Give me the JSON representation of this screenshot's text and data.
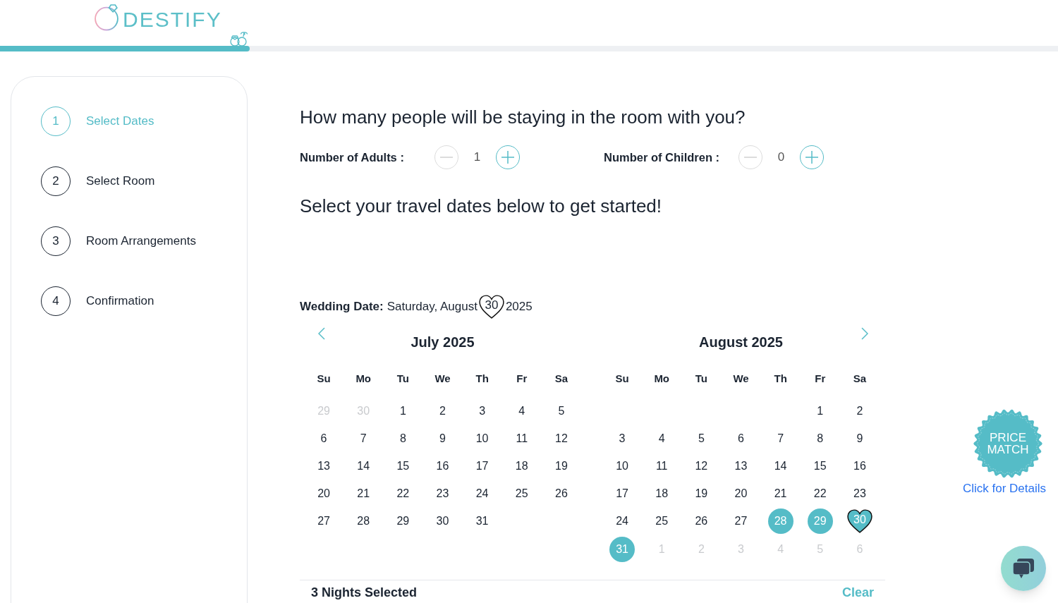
{
  "logo": {
    "text": "DESTIFY"
  },
  "progress": {
    "level": 0.236
  },
  "steps": [
    {
      "number": "1",
      "label": "Select Dates",
      "selected": true
    },
    {
      "number": "2",
      "label": "Select Room",
      "selected": false
    },
    {
      "number": "3",
      "label": "Room Arrangements",
      "selected": false
    },
    {
      "number": "4",
      "label": "Confirmation",
      "selected": false
    }
  ],
  "guests": {
    "title": "How many people will be staying in the room with you?",
    "counters": [
      {
        "label": "Number of Adults :",
        "value": "1",
        "minus_disabled": true
      },
      {
        "label": "Number of Children :",
        "value": "0",
        "minus_disabled": true
      }
    ]
  },
  "dates_prompt": "Select your travel dates below to get started!",
  "wedding_date": {
    "label": "Wedding Date:",
    "weekday_month": "Saturday, August",
    "day": "30",
    "year": "2025"
  },
  "calendar": {
    "prev_button": true,
    "next_button": true,
    "months": [
      {
        "title": "July 2025",
        "weekdays": [
          "Su",
          "Mo",
          "Tu",
          "We",
          "Th",
          "Fr",
          "Sa"
        ],
        "weeks": [
          {
            "kind": "standard",
            "days": [
              {
                "label": "29",
                "kind": "outside"
              },
              {
                "label": "30",
                "kind": "outside"
              },
              {
                "label": "1",
                "kind": "day",
                "selected": false
              },
              {
                "label": "2",
                "kind": "day",
                "selected": false
              },
              {
                "label": "3",
                "kind": "day",
                "selected": false
              },
              {
                "label": "4",
                "kind": "day",
                "selected": false
              },
              {
                "label": "5",
                "kind": "day",
                "selected": false
              }
            ]
          },
          {
            "kind": "standard",
            "days": [
              {
                "label": "6",
                "kind": "day",
                "selected": false
              },
              {
                "label": "7",
                "kind": "day",
                "selected": false
              },
              {
                "label": "8",
                "kind": "day",
                "selected": false
              },
              {
                "label": "9",
                "kind": "day",
                "selected": false
              },
              {
                "label": "10",
                "kind": "day",
                "selected": false
              },
              {
                "label": "11",
                "kind": "day",
                "selected": false
              },
              {
                "label": "12",
                "kind": "day",
                "selected": false
              }
            ]
          },
          {
            "kind": "standard",
            "days": [
              {
                "label": "13",
                "kind": "day",
                "selected": false
              },
              {
                "label": "14",
                "kind": "day",
                "selected": false
              },
              {
                "label": "15",
                "kind": "day",
                "selected": false
              },
              {
                "label": "16",
                "kind": "day",
                "selected": false
              },
              {
                "label": "17",
                "kind": "day",
                "selected": false
              },
              {
                "label": "18",
                "kind": "day",
                "selected": false
              },
              {
                "label": "19",
                "kind": "day",
                "selected": false
              }
            ]
          },
          {
            "kind": "standard",
            "days": [
              {
                "label": "20",
                "kind": "day",
                "selected": false
              },
              {
                "label": "21",
                "kind": "day",
                "selected": false
              },
              {
                "label": "22",
                "kind": "day",
                "selected": false
              },
              {
                "label": "23",
                "kind": "day",
                "selected": false
              },
              {
                "label": "24",
                "kind": "day",
                "selected": false
              },
              {
                "label": "25",
                "kind": "day",
                "selected": false
              },
              {
                "label": "26",
                "kind": "day",
                "selected": false
              }
            ]
          },
          {
            "kind": "standard",
            "days": [
              {
                "label": "27",
                "kind": "day",
                "selected": false
              },
              {
                "label": "28",
                "kind": "day",
                "selected": false
              },
              {
                "label": "29",
                "kind": "day",
                "selected": false
              },
              {
                "label": "30",
                "kind": "day",
                "selected": false
              },
              {
                "label": "31",
                "kind": "day",
                "selected": false
              }
            ]
          }
        ]
      },
      {
        "title": "August 2025",
        "weekdays": [
          "Su",
          "Mo",
          "Tu",
          "We",
          "Th",
          "Fr",
          "Sa"
        ],
        "weeks": [
          {
            "kind": "leading",
            "days": [
              {
                "label": "1",
                "kind": "day",
                "selected": false
              },
              {
                "label": "2",
                "kind": "day",
                "selected": false
              }
            ]
          },
          {
            "kind": "standard",
            "days": [
              {
                "label": "3",
                "kind": "day",
                "selected": false
              },
              {
                "label": "4",
                "kind": "day",
                "selected": false
              },
              {
                "label": "5",
                "kind": "day",
                "selected": false
              },
              {
                "label": "6",
                "kind": "day",
                "selected": false
              },
              {
                "label": "7",
                "kind": "day",
                "selected": false
              },
              {
                "label": "8",
                "kind": "day",
                "selected": false
              },
              {
                "label": "9",
                "kind": "day",
                "selected": false
              }
            ]
          },
          {
            "kind": "standard",
            "days": [
              {
                "label": "10",
                "kind": "day",
                "selected": false
              },
              {
                "label": "11",
                "kind": "day",
                "selected": false
              },
              {
                "label": "12",
                "kind": "day",
                "selected": false
              },
              {
                "label": "13",
                "kind": "day",
                "selected": false
              },
              {
                "label": "14",
                "kind": "day",
                "selected": false
              },
              {
                "label": "15",
                "kind": "day",
                "selected": false
              },
              {
                "label": "16",
                "kind": "day",
                "selected": false
              }
            ]
          },
          {
            "kind": "standard",
            "days": [
              {
                "label": "17",
                "kind": "day",
                "selected": false
              },
              {
                "label": "18",
                "kind": "day",
                "selected": false
              },
              {
                "label": "19",
                "kind": "day",
                "selected": false
              },
              {
                "label": "20",
                "kind": "day",
                "selected": false
              },
              {
                "label": "21",
                "kind": "day",
                "selected": false
              },
              {
                "label": "22",
                "kind": "day",
                "selected": false
              },
              {
                "label": "23",
                "kind": "day",
                "selected": false
              }
            ]
          },
          {
            "kind": "standard",
            "days": [
              {
                "label": "24",
                "kind": "day",
                "selected": false
              },
              {
                "label": "25",
                "kind": "day",
                "selected": false
              },
              {
                "label": "26",
                "kind": "day",
                "selected": false
              },
              {
                "label": "27",
                "kind": "day",
                "selected": false
              },
              {
                "label": "28",
                "kind": "day",
                "selected": true
              },
              {
                "label": "29",
                "kind": "day",
                "selected": true
              },
              {
                "label": "30",
                "kind": "wedding",
                "selected": true
              }
            ]
          },
          {
            "kind": "standard",
            "days": [
              {
                "label": "31",
                "kind": "day",
                "selected": true
              },
              {
                "label": "1",
                "kind": "outside"
              },
              {
                "label": "2",
                "kind": "outside"
              },
              {
                "label": "3",
                "kind": "outside"
              },
              {
                "label": "4",
                "kind": "outside"
              },
              {
                "label": "5",
                "kind": "outside"
              },
              {
                "label": "6",
                "kind": "outside"
              }
            ]
          }
        ]
      }
    ]
  },
  "summary": {
    "nights": "3 Nights Selected",
    "clear": "Clear"
  },
  "price_match": {
    "badge": "PRICE MATCH",
    "link": "Click for Details"
  }
}
